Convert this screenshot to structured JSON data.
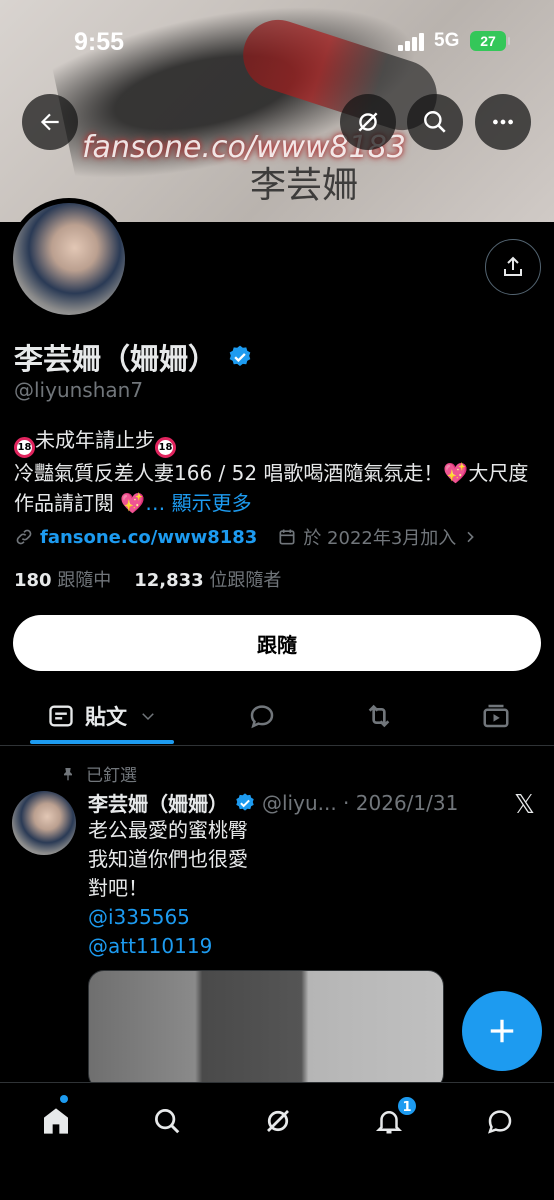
{
  "status": {
    "time": "9:55",
    "network": "5G",
    "battery": "27"
  },
  "banner": {
    "watermark_url": "fansone.co/www8183",
    "watermark_name": "李芸姍"
  },
  "profile": {
    "name": "李芸姍（姍姍）",
    "handle": "@liyunshan7",
    "bio_line1": "未成年請止步",
    "bio_line2": "冷豔氣質反差人妻166 / 52 唱歌喝酒隨氣氛走！💖大尺度作品請訂閱 💖",
    "show_more": "… 顯示更多",
    "link": "fansone.co/www8183",
    "joined": "於 2022年3月加入",
    "following_count": "180",
    "following_label": "跟隨中",
    "followers_count": "12,833",
    "followers_label": "位跟隨者",
    "follow_button": "跟隨"
  },
  "tabs": {
    "posts_label": "貼文"
  },
  "pinned_post": {
    "pinned_label": "已釘選",
    "name": "李芸姍（姍姍）",
    "handle_date": "@liyu... · 2026/1/31",
    "lines": [
      "老公最愛的蜜桃臀",
      "我知道你們也很愛",
      "對吧！"
    ],
    "mentions": [
      "@i335565",
      "@att110119"
    ]
  },
  "bottom_nav": {
    "notification_badge": "1"
  },
  "colors": {
    "accent": "#1d9bf0",
    "background": "#000000",
    "muted": "#71767b"
  }
}
